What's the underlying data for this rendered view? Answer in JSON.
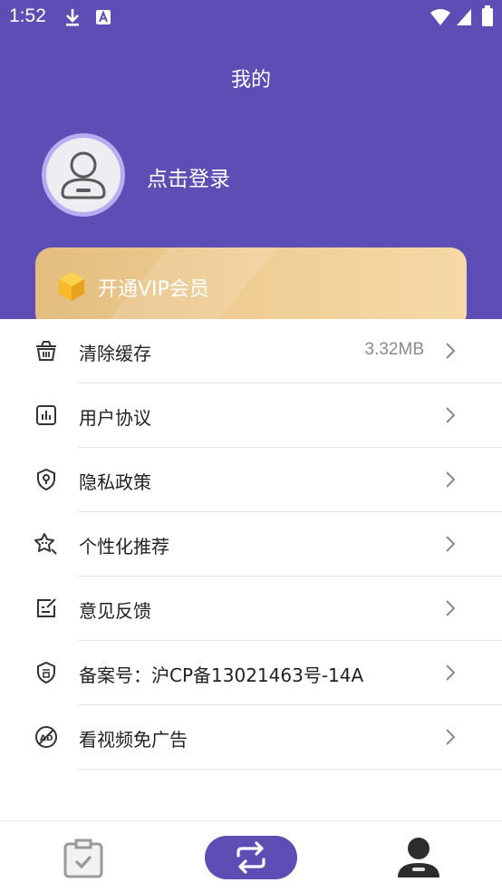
{
  "status_bar": {
    "time": "1:52"
  },
  "header": {
    "title": "我的",
    "login_text": "点击登录"
  },
  "vip": {
    "label": "开通VIP会员"
  },
  "menu": [
    {
      "label": "清除缓存",
      "value": "3.32MB",
      "icon": "basket-icon"
    },
    {
      "label": "用户协议",
      "value": "",
      "icon": "bar-chart-icon"
    },
    {
      "label": "隐私政策",
      "value": "",
      "icon": "shield-lock-icon"
    },
    {
      "label": "个性化推荐",
      "value": "",
      "icon": "sparkle-star-icon"
    },
    {
      "label": "意见反馈",
      "value": "",
      "icon": "edit-note-icon"
    },
    {
      "label": "备案号：沪CP备13021463号-14A",
      "value": "",
      "icon": "record-badge-icon"
    },
    {
      "label": "看视频免广告",
      "value": "",
      "icon": "no-ads-icon"
    }
  ],
  "tabs": [
    {
      "name": "tasks",
      "icon": "clipboard-check-icon"
    },
    {
      "name": "convert",
      "icon": "swap-arrows-icon"
    },
    {
      "name": "mine",
      "icon": "user-icon"
    }
  ],
  "colors": {
    "primary": "#5d4eb6",
    "vip_gold": "#eccb91",
    "text": "#222222",
    "muted": "#8b8b8b"
  }
}
